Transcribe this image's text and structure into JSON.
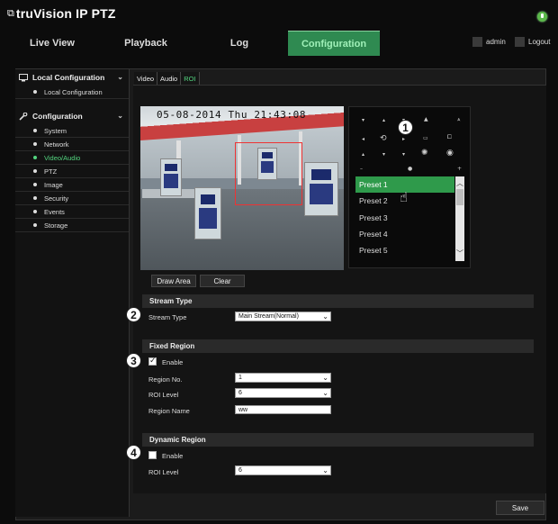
{
  "app": {
    "brand": "truVision  IP PTZ"
  },
  "nav": {
    "tabs": [
      {
        "label": "Live View"
      },
      {
        "label": "Playback"
      },
      {
        "label": "Log"
      },
      {
        "label": "Configuration"
      }
    ]
  },
  "user": {
    "name": "admin",
    "logout": "Logout"
  },
  "sidebar": {
    "local": {
      "title": "Local Configuration",
      "items": [
        "Local Configuration"
      ]
    },
    "config": {
      "title": "Configuration",
      "items": [
        "System",
        "Network",
        "Video/Audio",
        "PTZ",
        "Image",
        "Security",
        "Events",
        "Storage"
      ]
    }
  },
  "subtabs": [
    "Video",
    "Audio",
    "ROI"
  ],
  "camera": {
    "osd": "05-08-2014 Thu 21:43:08"
  },
  "presets": [
    "Preset 1",
    "Preset 2",
    "Preset 3",
    "Preset 4",
    "Preset 5"
  ],
  "buttons": {
    "draw": "Draw Area",
    "clear": "Clear",
    "save": "Save"
  },
  "stream": {
    "title": "Stream Type",
    "label": "Stream Type",
    "value": "Main Stream(Normal)"
  },
  "fixed": {
    "title": "Fixed Region",
    "enable": "Enable",
    "region_no_label": "Region No.",
    "region_no": "1",
    "roi_label": "ROI Level",
    "roi": "6",
    "name_label": "Region Name",
    "name": "ww"
  },
  "dynamic": {
    "title": "Dynamic Region",
    "enable": "Enable",
    "roi_label": "ROI Level",
    "roi": "6"
  },
  "callouts": [
    "1",
    "2",
    "3",
    "4"
  ],
  "colors": {
    "accent": "#2f8a51",
    "active_text": "#53d47f",
    "roi_box": "#ee3333"
  }
}
